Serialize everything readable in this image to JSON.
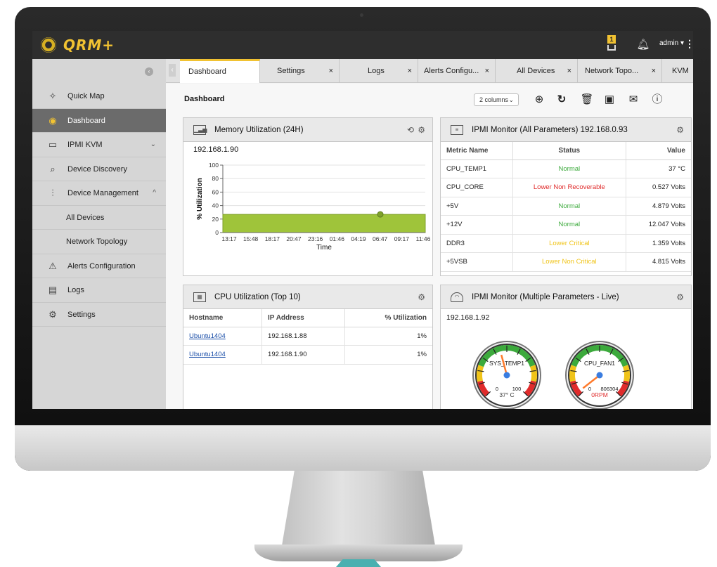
{
  "app": {
    "brand": "QRM+"
  },
  "topbar": {
    "notify_count": "1",
    "user": "admin ▾",
    "more": "⋮"
  },
  "sidebar": {
    "items": [
      {
        "label": "Quick Map",
        "icon": "✧"
      },
      {
        "label": "Dashboard",
        "icon": "◉"
      },
      {
        "label": "IPMI KVM",
        "icon": "▭",
        "caret": "⌄"
      },
      {
        "label": "Device Discovery",
        "icon": "⌕"
      },
      {
        "label": "Device Management",
        "icon": "⫶",
        "caret": "^"
      },
      {
        "label": "All Devices"
      },
      {
        "label": "Network Topology"
      },
      {
        "label": "Alerts Configuration",
        "icon": "⚠"
      },
      {
        "label": "Logs",
        "icon": "▤"
      },
      {
        "label": "Settings",
        "icon": "⚙"
      }
    ]
  },
  "tabs": [
    {
      "label": "Dashboard"
    },
    {
      "label": "Settings",
      "close": "×"
    },
    {
      "label": "Logs",
      "close": "×"
    },
    {
      "label": "Alerts Configu...",
      "close": "×"
    },
    {
      "label": "All Devices",
      "close": "×"
    },
    {
      "label": "Network Topo...",
      "close": "×"
    },
    {
      "label": "KVM D"
    }
  ],
  "content": {
    "title": "Dashboard",
    "columns": "2 columns",
    "columns_caret": "⌄"
  },
  "memory_panel": {
    "title": "Memory Utilization (24H)",
    "host": "192.168.1.90"
  },
  "ipmi_all": {
    "title": "IPMI Monitor (All Parameters) 192.168.0.93",
    "headers": [
      "Metric Name",
      "Status",
      "Value"
    ],
    "rows": [
      {
        "metric": "CPU_TEMP1",
        "status": "Normal",
        "value": "37 °C",
        "color": "#3caa3c"
      },
      {
        "metric": "CPU_CORE",
        "status": "Lower Non Recoverable",
        "value": "0.527 Volts",
        "color": "#e02b2b"
      },
      {
        "metric": "+5V",
        "status": "Normal",
        "value": "4.879 Volts",
        "color": "#3caa3c"
      },
      {
        "metric": "+12V",
        "status": "Normal",
        "value": "12.047 Volts",
        "color": "#3caa3c"
      },
      {
        "metric": "DDR3",
        "status": "Lower Critical",
        "value": "1.359 Volts",
        "color": "#f0c419"
      },
      {
        "metric": "+5VSB",
        "status": "Lower Non Critical",
        "value": "4.815 Volts",
        "color": "#f0c419"
      }
    ]
  },
  "cpu_panel": {
    "title": "CPU Utilization (Top 10)",
    "headers": [
      "Hostname",
      "IP Address",
      "% Utilization"
    ],
    "rows": [
      {
        "host": "Ubuntu1404",
        "ip": "192.168.1.88",
        "util": "1%"
      },
      {
        "host": "Ubuntu1404",
        "ip": "192.168.1.90",
        "util": "1%"
      }
    ]
  },
  "ipmi_live": {
    "title": "IPMI Monitor (Multiple Parameters - Live)",
    "host": "192.168.1.92",
    "gauges": [
      {
        "name": "SYS_TEMP1",
        "value": 37,
        "max": 100,
        "min_label": "0",
        "max_label": "100",
        "readout": "37° C",
        "readout_color": "#333"
      },
      {
        "name": "CPU_FAN1",
        "value": 0,
        "max": 806304,
        "min_label": "0",
        "max_label": "806304",
        "readout": "0RPM",
        "readout_color": "#e02b2b"
      }
    ]
  },
  "chart_data": {
    "type": "area",
    "title": "",
    "xlabel": "Time",
    "ylabel": "% Utilization",
    "ylim": [
      0,
      100
    ],
    "yticks": [
      0,
      20,
      40,
      60,
      80,
      100
    ],
    "categories": [
      "13:17",
      "15:48",
      "18:17",
      "20:47",
      "23:16",
      "01:46",
      "04:19",
      "06:47",
      "09:17",
      "11:46"
    ],
    "series": [
      {
        "values": [
          27,
          27,
          27,
          27,
          27,
          27,
          27,
          27,
          27,
          27
        ],
        "color": "#9fc43a"
      }
    ],
    "marker": {
      "category": "06:47",
      "value": 27
    },
    "grid": true
  }
}
